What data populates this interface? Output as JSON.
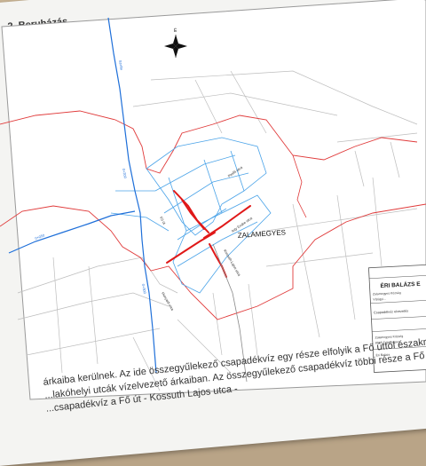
{
  "document": {
    "section_heading": "2. Beruházás ...",
    "body_lines": [
      "árkaiba kerülnek. Az ide összegyűlekező csapadékvíz egy része elfolyik a Fő úttól északra,",
      "...lakóhelyi utcák vízelvezető árkaiban. Az összegyűlekező csapadékvíz többi része a Fő út",
      "...csapadékvíz a Fő út - Kossuth Lajos utca -"
    ]
  },
  "map": {
    "village_name": "ZALAMEGYES",
    "north_symbol": "north-arrow",
    "colors": {
      "boundary_red": "#e03a3a",
      "stream_blue": "#1e6fd9",
      "parcel_blue": "#4aa3e8",
      "road_red": "#e01818",
      "parcel_gray": "#b8b8b8"
    },
    "street_labels": [
      "Fő út",
      "Kossuth Lajos utca",
      "Petőfi utca",
      "Ady Endre utca",
      "Hunyadi utca"
    ],
    "title_block": {
      "designer": "ÉRI BALÁZS E",
      "rows": [
        "Zalamegyes Község",
        "Vízügyi...",
        "Csapadékvíz elvezetés",
        "Zalamegyes Község",
        "8946 Zalamegyes",
        "Éri Balázs"
      ]
    }
  }
}
